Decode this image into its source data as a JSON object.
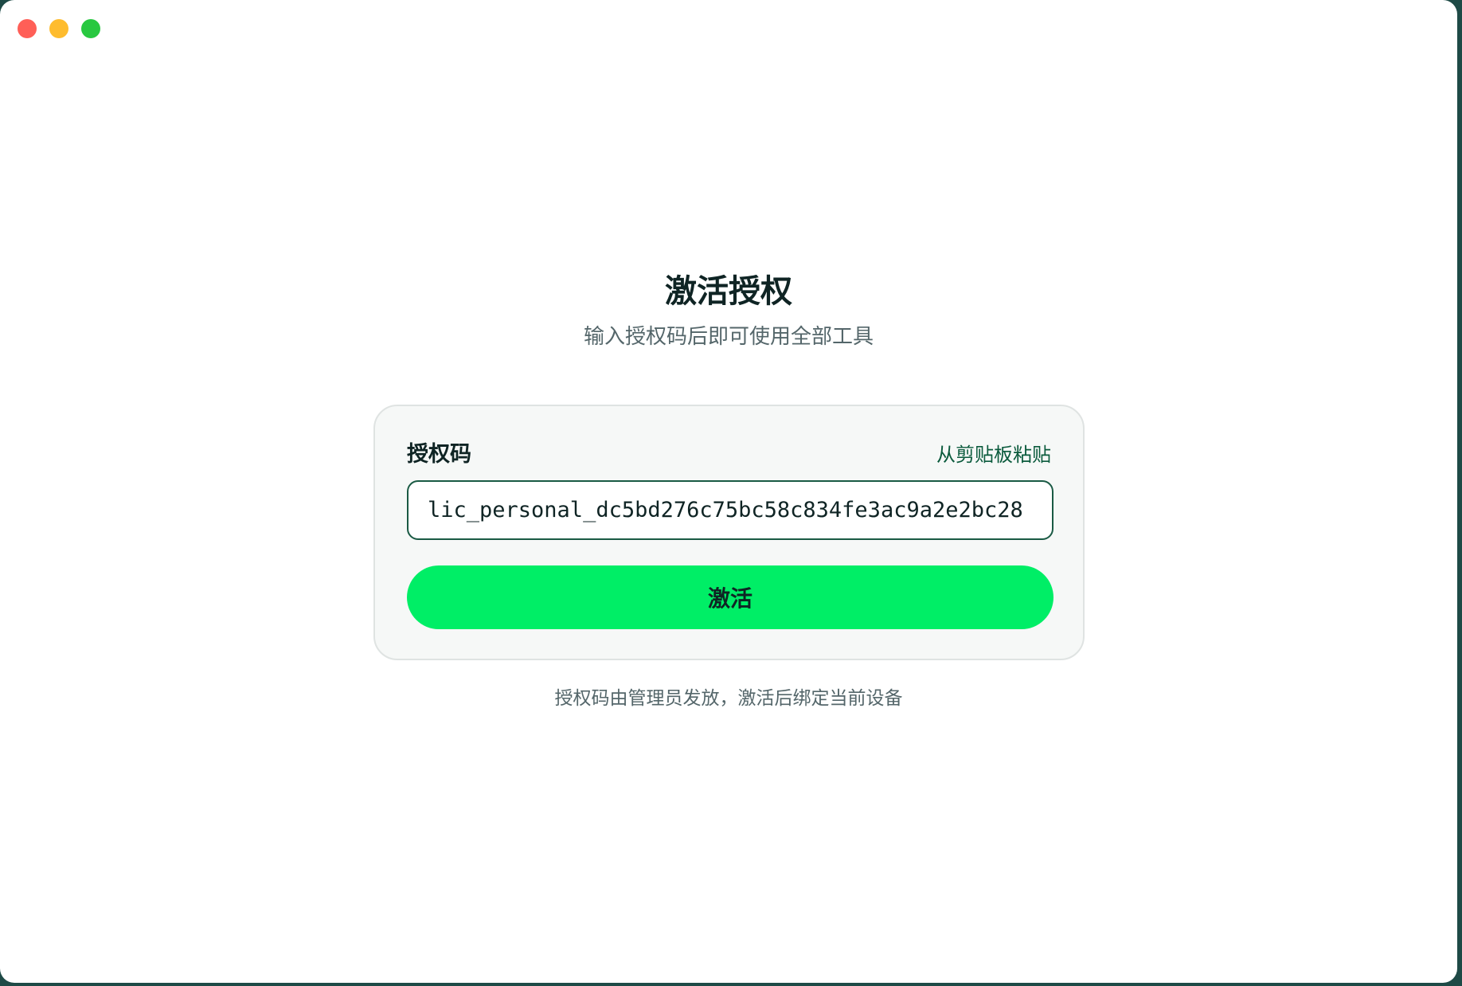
{
  "window": {
    "controls": [
      "close",
      "minimize",
      "maximize"
    ]
  },
  "header": {
    "title": "激活授权",
    "subtitle": "输入授权码后即可使用全部工具"
  },
  "form": {
    "label": "授权码",
    "paste_link": "从剪贴板粘贴",
    "license_value": "lic_personal_dc5bd276c75bc58c834fe3ac9a2e2bc28",
    "activate_label": "激活"
  },
  "footer": {
    "note": "授权码由管理员发放，激活后绑定当前设备"
  },
  "colors": {
    "accent": "#00ee66",
    "link": "#0a5a3c",
    "input_border": "#1a5a44",
    "close": "#ff5f57",
    "minimize": "#febc2e",
    "maximize": "#28c840"
  }
}
